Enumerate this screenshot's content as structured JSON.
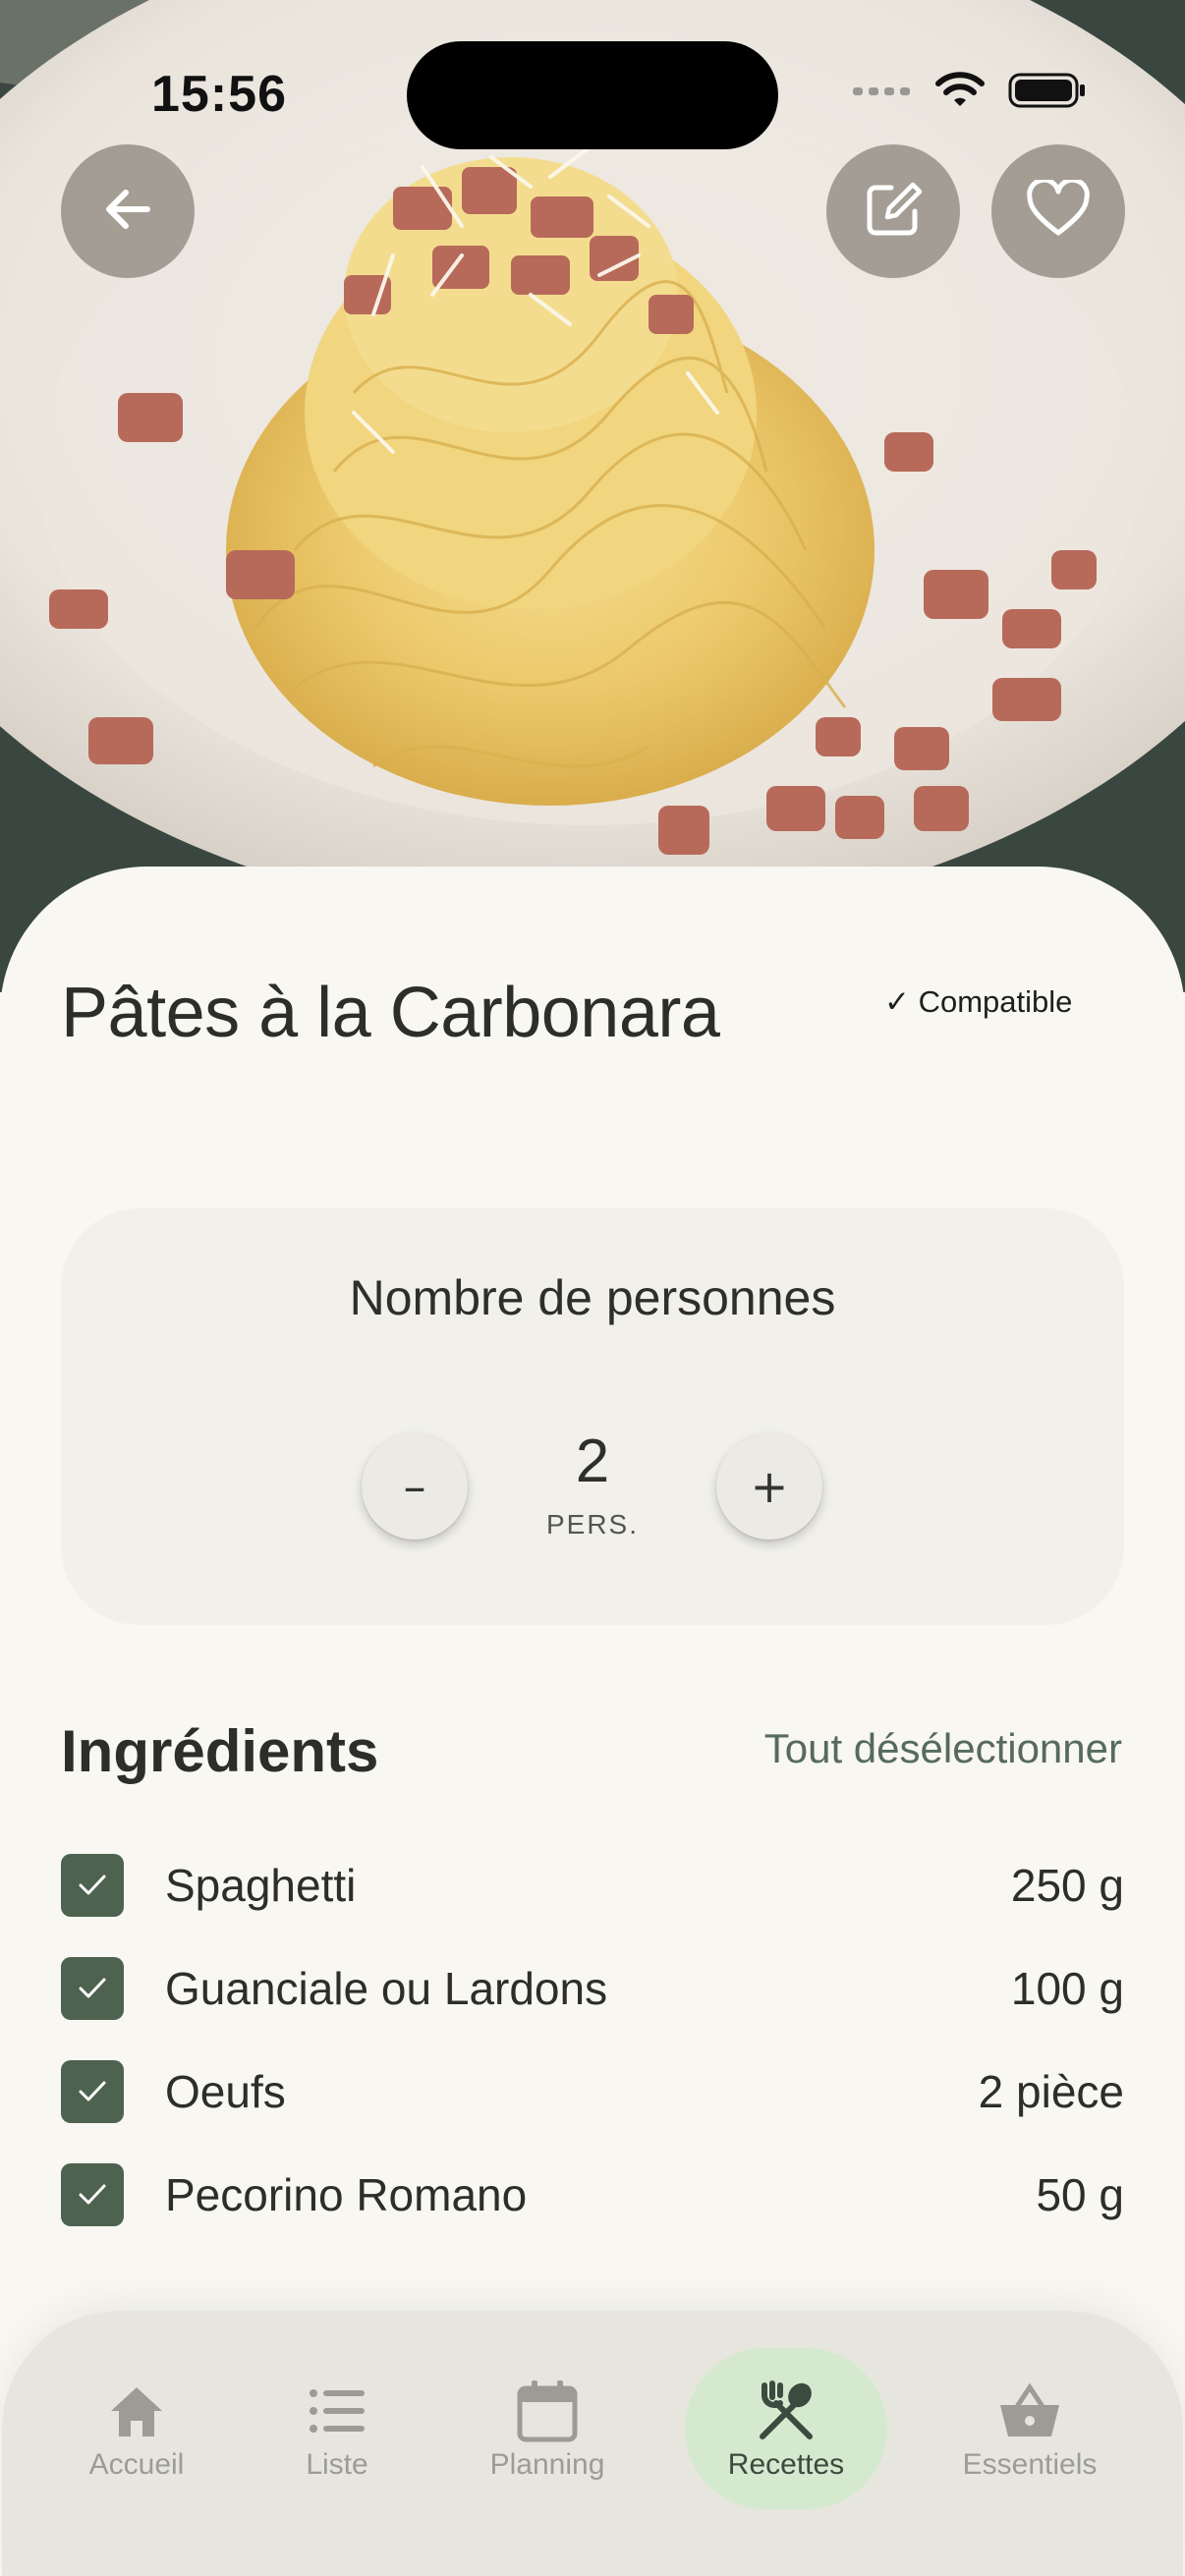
{
  "status_bar": {
    "time": "15:56"
  },
  "hero": {
    "image_alt": "Assiette de spaghetti carbonara"
  },
  "actions": {
    "back": "back-arrow-icon",
    "edit": "edit-icon",
    "favorite": "heart-icon"
  },
  "recipe": {
    "title": "Pâtes à la Carbonara",
    "compatibility_badge": "✓ Compatible"
  },
  "servings": {
    "title": "Nombre de personnes",
    "value": "2",
    "unit": "PERS.",
    "decrement_label": "–",
    "increment_label": "+"
  },
  "ingredients": {
    "heading": "Ingrédients",
    "toggle_all_label": "Tout désélectionner",
    "items": [
      {
        "name": "Spaghetti",
        "quantity": "250 g",
        "checked": true
      },
      {
        "name": "Guanciale ou Lardons",
        "quantity": "100 g",
        "checked": true
      },
      {
        "name": "Oeufs",
        "quantity": "2 pièce",
        "checked": true
      },
      {
        "name": "Pecorino Romano",
        "quantity": "50 g",
        "checked": true
      }
    ]
  },
  "tabbar": {
    "tabs": [
      {
        "label": "Accueil",
        "icon": "home-icon"
      },
      {
        "label": "Liste",
        "icon": "list-icon"
      },
      {
        "label": "Planning",
        "icon": "calendar-icon"
      },
      {
        "label": "Recettes",
        "icon": "fork-spoon-icon",
        "active": true
      },
      {
        "label": "Essentiels",
        "icon": "basket-icon"
      }
    ]
  },
  "colors": {
    "accent_green": "#4d624f",
    "active_tab_bg": "#d5e9cf",
    "link_green": "#566b5a",
    "background": "#f8f7f2"
  }
}
